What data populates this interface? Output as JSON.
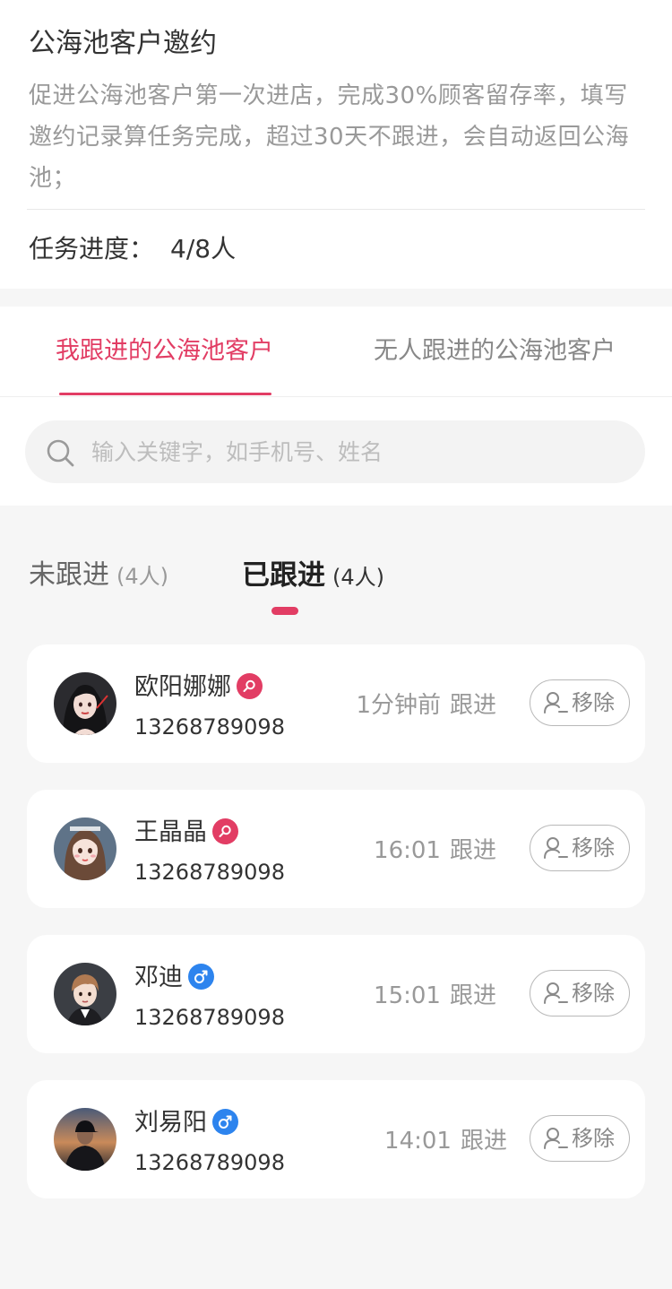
{
  "task": {
    "title": "公海池客户邀约",
    "description": "促进公海池客户第一次进店，完成30%顾客留存率，填写邀约记录算任务完成，超过30天不跟进，会自动返回公海池；",
    "progress_label": "任务进度：",
    "progress_value": "4/8人",
    "progress_done": 4,
    "progress_total": 8
  },
  "tabs": [
    {
      "label": "我跟进的公海池客户",
      "active": true
    },
    {
      "label": "无人跟进的公海池客户",
      "active": false
    }
  ],
  "search": {
    "placeholder": "输入关键字，如手机号、姓名",
    "icon": "search-icon"
  },
  "subtabs": [
    {
      "label": "未跟进",
      "count": "(4人)",
      "active": false
    },
    {
      "label": "已跟进",
      "count": "(4人)",
      "active": true
    }
  ],
  "colors": {
    "accent": "#e23d64",
    "female": "#e23d64",
    "male": "#2d84ee",
    "background": "#f6f6f6"
  },
  "customers": [
    {
      "name": "欧阳娜娜",
      "gender": "female",
      "gender_icon": "female-icon",
      "phone": "13268789098",
      "time": "1分钟前",
      "action": "跟进",
      "remove_label": "移除",
      "avatar": "avatar-girl-dark-hair"
    },
    {
      "name": "王晶晶",
      "gender": "female",
      "gender_icon": "female-icon",
      "phone": "13268789098",
      "time": "16:01",
      "action": "跟进",
      "remove_label": "移除",
      "avatar": "avatar-girl-brown-hair"
    },
    {
      "name": "邓迪",
      "gender": "male",
      "gender_icon": "male-icon",
      "phone": "13268789098",
      "time": "15:01",
      "action": "跟进",
      "remove_label": "移除",
      "avatar": "avatar-boy-light-hair"
    },
    {
      "name": "刘易阳",
      "gender": "male",
      "gender_icon": "male-icon",
      "phone": "13268789098",
      "time": "14:01",
      "action": "跟进",
      "remove_label": "移除",
      "avatar": "avatar-man-cap-sunset"
    }
  ]
}
